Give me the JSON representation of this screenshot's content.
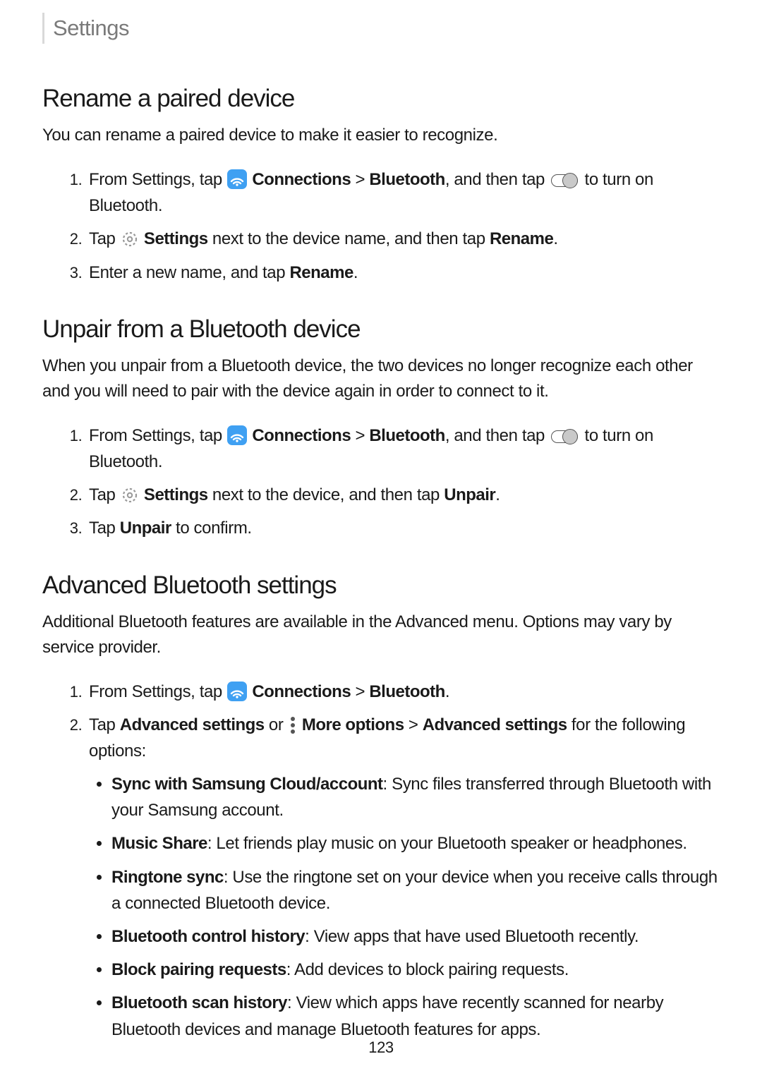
{
  "header": {
    "title": "Settings"
  },
  "page_number": "123",
  "sections": {
    "rename": {
      "heading": "Rename a paired device",
      "intro": "You can rename a paired device to make it easier to recognize.",
      "step1_a": "From Settings, tap ",
      "step1_b": " Connections",
      "step1_c": " > ",
      "step1_d": "Bluetooth",
      "step1_e": ", and then tap ",
      "step1_f": " to turn on Bluetooth.",
      "step2_a": "Tap ",
      "step2_b": " Settings",
      "step2_c": " next to the device name, and then tap ",
      "step2_d": "Rename",
      "step2_e": ".",
      "step3_a": "Enter a new name, and tap ",
      "step3_b": "Rename",
      "step3_c": "."
    },
    "unpair": {
      "heading": "Unpair from a Bluetooth device",
      "intro": "When you unpair from a Bluetooth device, the two devices no longer recognize each other and you will need to pair with the device again in order to connect to it.",
      "step1_a": "From Settings, tap ",
      "step1_b": " Connections",
      "step1_c": " > ",
      "step1_d": "Bluetooth",
      "step1_e": ", and then tap ",
      "step1_f": " to turn on Bluetooth.",
      "step2_a": "Tap ",
      "step2_b": " Settings",
      "step2_c": " next to the device, and then tap ",
      "step2_d": "Unpair",
      "step2_e": ".",
      "step3_a": "Tap ",
      "step3_b": "Unpair",
      "step3_c": " to confirm."
    },
    "advanced": {
      "heading": "Advanced Bluetooth settings",
      "intro": "Additional Bluetooth features are available in the Advanced menu. Options may vary by service provider.",
      "step1_a": "From Settings, tap ",
      "step1_b": " Connections",
      "step1_c": " > ",
      "step1_d": "Bluetooth",
      "step1_e": ".",
      "step2_a": "Tap ",
      "step2_b": "Advanced settings",
      "step2_c": " or ",
      "step2_d": " More options",
      "step2_e": " > ",
      "step2_f": "Advanced settings",
      "step2_g": " for the following options:",
      "bullets": {
        "b1_bold": "Sync with Samsung Cloud/account",
        "b1_rest": ": Sync files transferred through Bluetooth with your Samsung account.",
        "b2_bold": "Music Share",
        "b2_rest": ": Let friends play music on your Bluetooth speaker or headphones.",
        "b3_bold": "Ringtone sync",
        "b3_rest": ": Use the ringtone set on your device when you receive calls through a connected Bluetooth device.",
        "b4_bold": "Bluetooth control history",
        "b4_rest": ": View apps that have used Bluetooth recently.",
        "b5_bold": "Block pairing requests",
        "b5_rest": ": Add devices to block pairing requests.",
        "b6_bold": "Bluetooth scan history",
        "b6_rest": ": View which apps have recently scanned for nearby Bluetooth devices and manage Bluetooth features for apps."
      }
    }
  }
}
